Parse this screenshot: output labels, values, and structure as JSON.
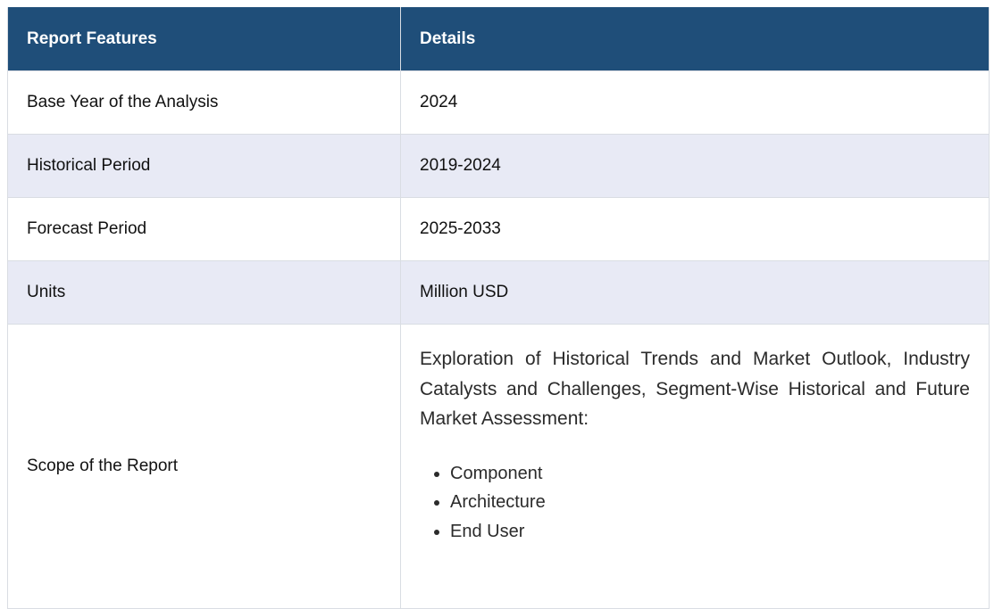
{
  "table": {
    "headers": [
      "Report Features",
      "Details"
    ],
    "rows": [
      {
        "feature": "Base Year of the Analysis",
        "detail": "2024"
      },
      {
        "feature": "Historical Period",
        "detail": "2019-2024"
      },
      {
        "feature": "Forecast Period",
        "detail": "2025-2033"
      },
      {
        "feature": "Units",
        "detail": "Million USD"
      }
    ],
    "scope": {
      "feature": "Scope of the Report",
      "text": "Exploration of Historical Trends and Market Outlook, Industry Catalysts and Challenges, Segment-Wise Historical and Future Market Assessment:",
      "items": [
        "Component",
        "Architecture",
        "End User"
      ]
    }
  }
}
